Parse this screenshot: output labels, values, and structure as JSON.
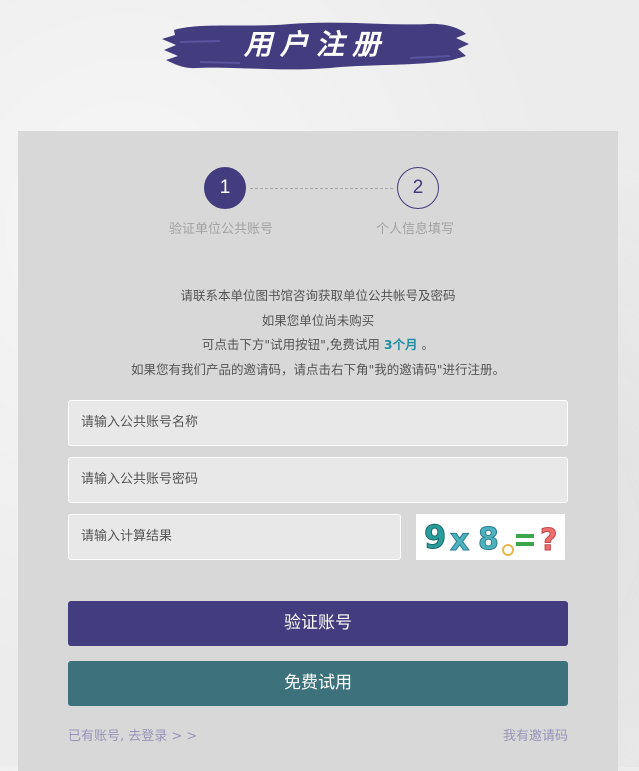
{
  "header": {
    "title": "用户注册",
    "banner_color": "#433c7e"
  },
  "steps": [
    {
      "number": "1",
      "label": "验证单位公共账号",
      "active": true
    },
    {
      "number": "2",
      "label": "个人信息填写",
      "active": false
    }
  ],
  "info": {
    "line1": "请联系本单位图书馆咨询获取单位公共帐号及密码",
    "line2": "如果您单位尚未购买",
    "line3_prefix": "可点击下方\"试用按钮\",免费试用 ",
    "line3_highlight": "3个月",
    "line3_suffix": " 。",
    "line4": "如果您有我们产品的邀请码，请点击右下角\"我的邀请码\"进行注册。"
  },
  "form": {
    "account_placeholder": "请输入公共账号名称",
    "password_placeholder": "请输入公共账号密码",
    "captcha_placeholder": "请输入计算结果",
    "captcha_text": "9×8=?"
  },
  "buttons": {
    "verify": "验证账号",
    "trial": "免费试用",
    "verify_color": "#433c7e",
    "trial_color": "#3d727c"
  },
  "links": {
    "login": "已有账号, 去登录 > >",
    "invite": "我有邀请码"
  }
}
